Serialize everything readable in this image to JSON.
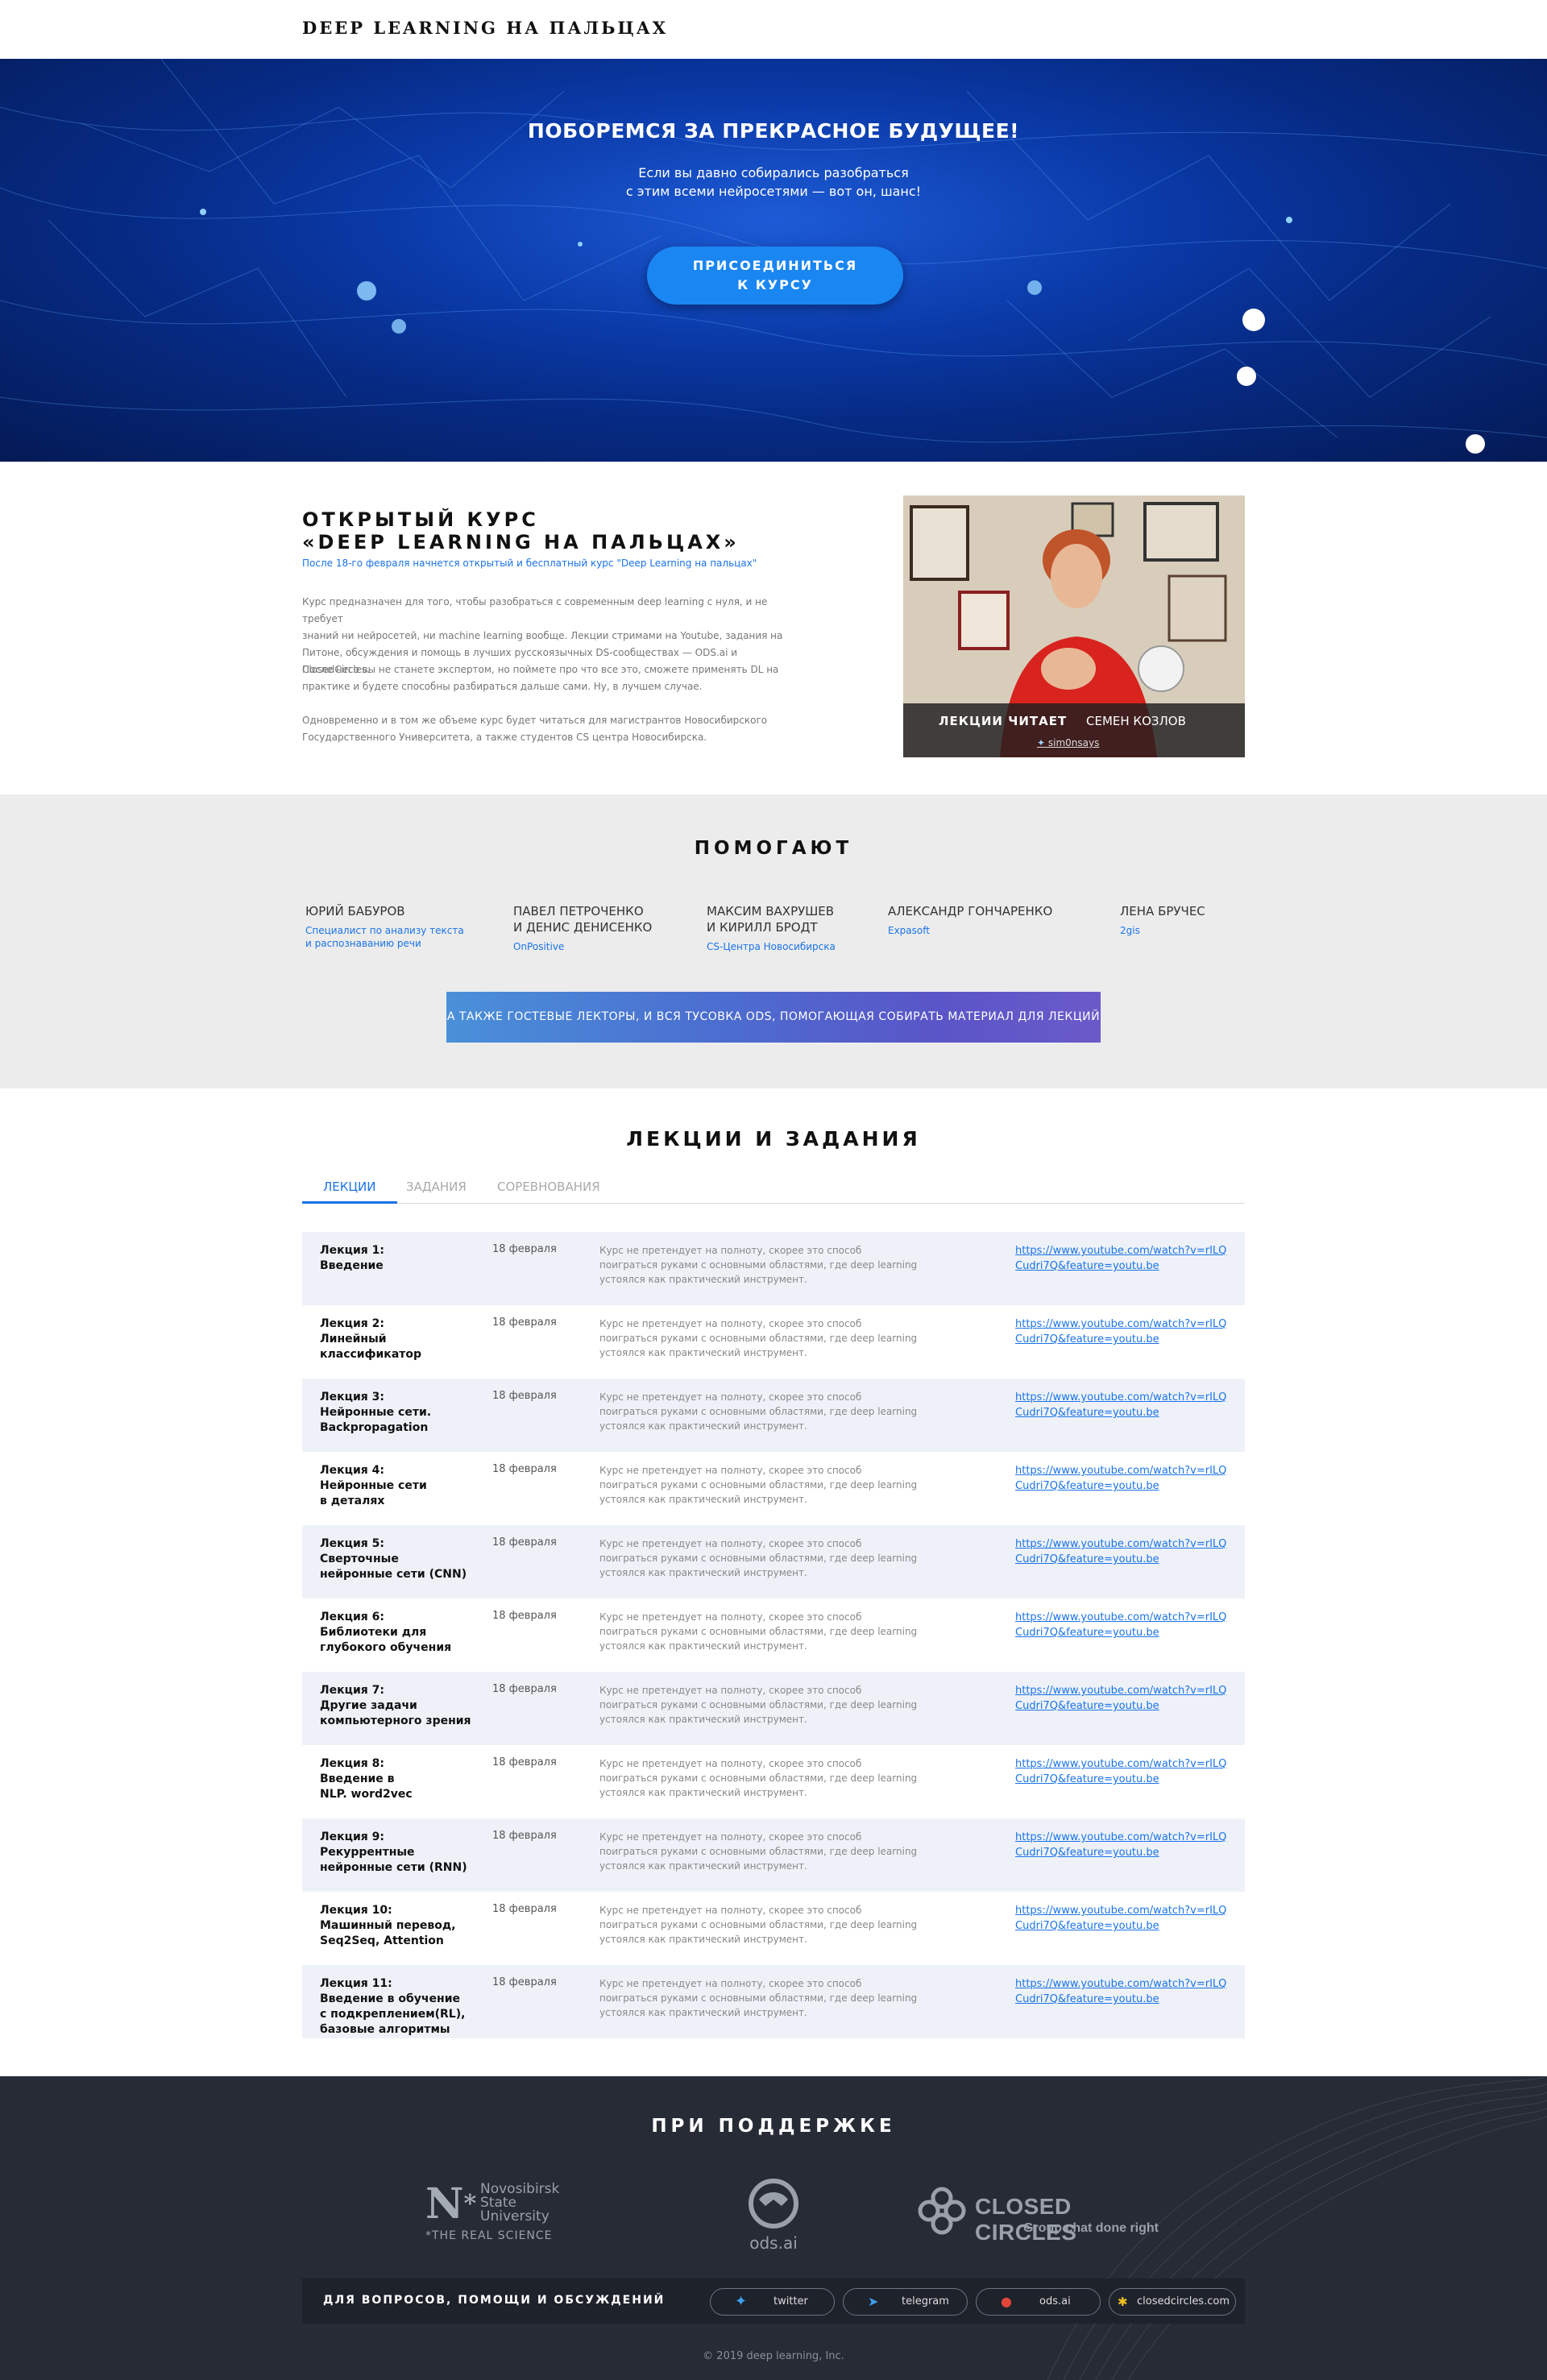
{
  "header": {
    "logo": "DEEP LEARNING НА ПАЛЬЦАХ"
  },
  "hero": {
    "title": "ПОБОРЕМСЯ ЗА ПРЕКРАСНОЕ БУДУЩЕЕ!",
    "subtitle_line1": "Если вы давно собирались разобраться",
    "subtitle_line2": "с этим всеми нейросетями — вот он, шанс!",
    "join_line1": "ПРИСОЕДИНИТЬСЯ",
    "join_line2": "К КУРСУ"
  },
  "about": {
    "title_line1": "ОТКРЫТЫЙ КУРС",
    "title_line2": "«DEEP LEARNING НА ПАЛЬЦАХ»",
    "lead": "После 18-го февраля начнется открытый и бесплатный курс \"Deep Learning на пальцах\"",
    "p1_l1": "Курс предназначен для того, чтобы разобраться с современным deep learning с нуля, и не требует",
    "p1_l2": "знаний ни нейросетей, ни machine learning вообще. Лекции стримами на Youtube, задания на",
    "p1_l3": "Питоне, обсуждения и помощь в лучших русскоязычных DS-сообществах — ODS.ai и ClosedCircles.",
    "p2_l1": "После него вы не станете экспертом, но поймете про что все это, сможете применять DL на",
    "p2_l2": "практике и будете способны разбираться дальше сами. Ну, в лучшем случае.",
    "p3_l1": "Одновременно и в том же объеме курс будет читаться для магистрантов Новосибирского",
    "p3_l2": "Государственного Университета, а также студентов CS центра Новосибирска.",
    "caption_label": "ЛЕКЦИИ ЧИТАЕТ",
    "caption_name": "СЕМЕН КОЗЛОВ",
    "caption_twitter": "sim0nsays"
  },
  "helpers": {
    "title": "ПОМОГАЮТ",
    "people": [
      {
        "name1": "ЮРИЙ БАБУРОВ",
        "name2": "",
        "org1": "Специалист по анализу текста",
        "org2": "и распознаванию речи"
      },
      {
        "name1": "ПАВЕЛ ПЕТРОЧЕНКО",
        "name2": "И ДЕНИС ДЕНИСЕНКО",
        "org1": "OnPositive",
        "org2": ""
      },
      {
        "name1": "МАКСИМ ВАХРУШЕВ",
        "name2": "И КИРИЛЛ БРОДТ",
        "org1": "CS-Центра Новосибирска",
        "org2": ""
      },
      {
        "name1": "АЛЕКСАНДР ГОНЧАРЕНКО",
        "name2": "",
        "org1": "Expasoft",
        "org2": ""
      },
      {
        "name1": "ЛЕНА БРУЧЕС",
        "name2": "",
        "org1": "2gis",
        "org2": ""
      }
    ],
    "guest_banner": "А ТАКЖЕ ГОСТЕВЫЕ ЛЕКТОРЫ, И ВСЯ ТУСОВКА ODS, ПОМОГАЮЩАЯ СОБИРАТЬ МАТЕРИАЛ ДЛЯ ЛЕКЦИЙ"
  },
  "lectures": {
    "title": "ЛЕКЦИИ И ЗАДАНИЯ",
    "tabs": [
      "ЛЕКЦИИ",
      "ЗАДАНИЯ",
      "СОРЕВНОВАНИЯ"
    ],
    "desc_l1": "Курс не претендует на полноту, скорее это способ",
    "desc_l2": "поиграться руками с основными областями, где deep learning",
    "desc_l3": "устоялся как практический инструмент.",
    "link_l1": "https://www.youtube.com/watch?v=rILQ",
    "link_l2": "Cudri7Q&feature=youtu.be",
    "rows": [
      {
        "l1": "Лекция 1:",
        "l2": "Введение",
        "l3": "",
        "l4": "",
        "date": "18 февраля"
      },
      {
        "l1": "Лекция 2:",
        "l2": "Линейный",
        "l3": "классификатор",
        "l4": "",
        "date": "18 февраля"
      },
      {
        "l1": "Лекция 3:",
        "l2": "Нейронные сети.",
        "l3": "Backpropagation",
        "l4": "",
        "date": "18 февраля"
      },
      {
        "l1": "Лекция 4:",
        "l2": "Нейронные сети",
        "l3": "в деталях",
        "l4": "",
        "date": "18 февраля"
      },
      {
        "l1": "Лекция 5:",
        "l2": "Сверточные",
        "l3": "нейронные сети (CNN)",
        "l4": "",
        "date": "18 февраля"
      },
      {
        "l1": "Лекция 6:",
        "l2": "Библиотеки для",
        "l3": "глубокого обучения",
        "l4": "",
        "date": "18 февраля"
      },
      {
        "l1": "Лекция 7:",
        "l2": "Другие задачи",
        "l3": "компьютерного зрения",
        "l4": "",
        "date": "18 февраля"
      },
      {
        "l1": "Лекция 8:",
        "l2": "Введение в",
        "l3": "NLP. word2vec",
        "l4": "",
        "date": "18 февраля"
      },
      {
        "l1": "Лекция 9:",
        "l2": "Рекуррентные",
        "l3": "нейронные сети (RNN)",
        "l4": "",
        "date": "18 февраля"
      },
      {
        "l1": "Лекция 10:",
        "l2": "Машинный перевод,",
        "l3": "Seq2Seq, Attention",
        "l4": "",
        "date": "18 февраля"
      },
      {
        "l1": "Лекция 11:",
        "l2": "Введение в обучение",
        "l3": "с подкреплением(RL),",
        "l4": "базовые алгоритмы",
        "date": "18 февраля"
      }
    ]
  },
  "support": {
    "title": "ПРИ ПОДДЕРЖКЕ",
    "nsu_l1": "Novosibirsk",
    "nsu_l2": "State",
    "nsu_l3": "University",
    "nsu_tag": "THE REAL SCIENCE",
    "ods": "ods.ai",
    "cc_name": "CLOSED CIRCLES",
    "cc_tag": "Group chat done right"
  },
  "contacts": {
    "label": "ДЛЯ ВОПРОСОВ, ПОМОЩИ И ОБСУЖДЕНИЙ",
    "twitter": "twitter",
    "telegram": "telegram",
    "ods": "ods.ai",
    "cc": "closedcircles.com"
  },
  "copyright": "© 2019 deep learning, Inc.",
  "colors": {
    "accent": "#1a73e8",
    "button": "#1a86f2",
    "footer": "#262b36",
    "helpers_bg": "#ececec",
    "row_shade": "#eef2f8"
  }
}
